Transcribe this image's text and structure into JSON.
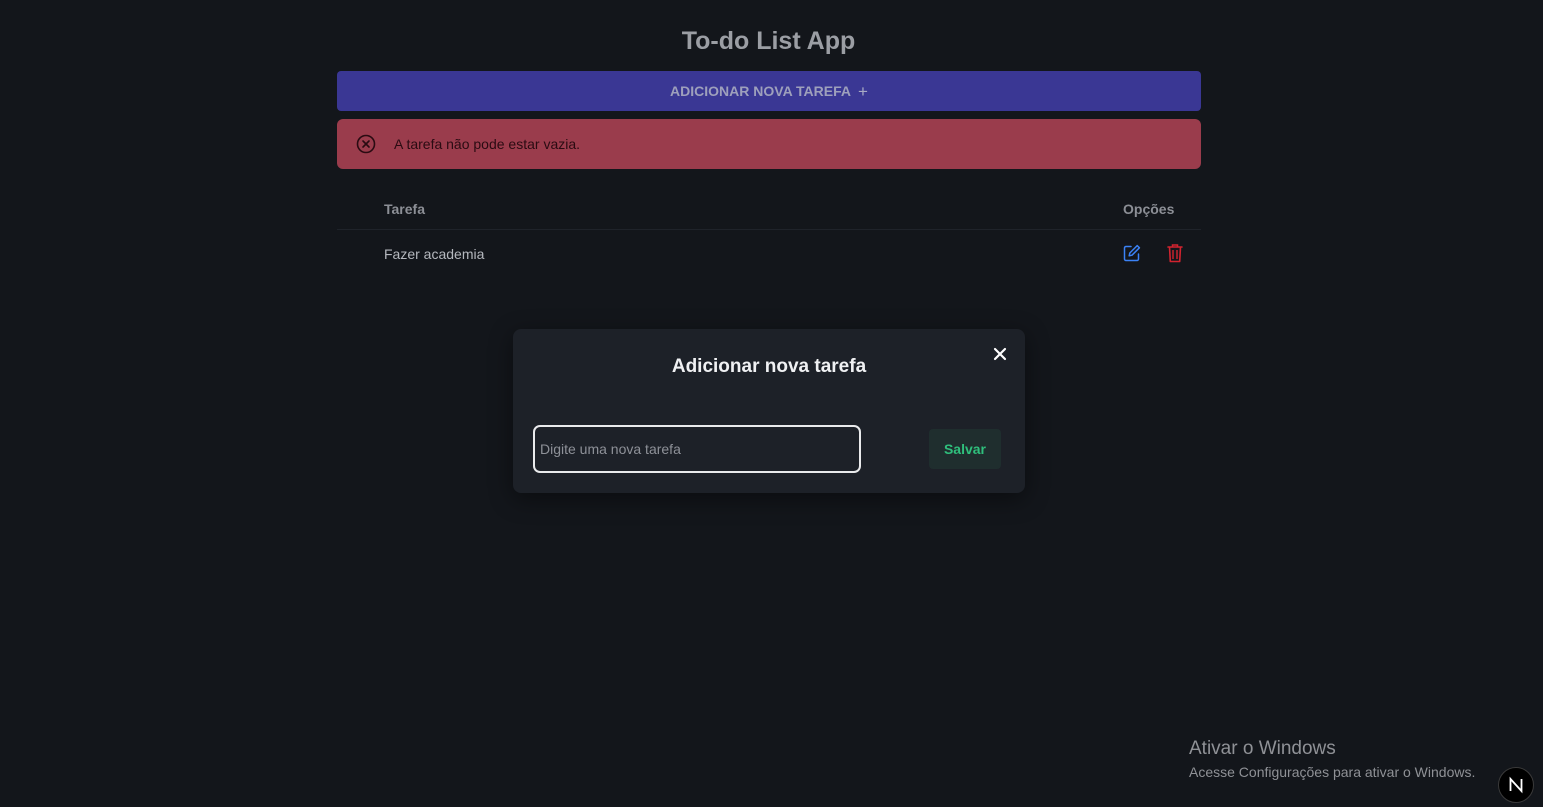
{
  "app": {
    "title": "To-do List App"
  },
  "toolbar": {
    "add_label": "ADICIONAR NOVA TAREFA",
    "add_icon": "plus-icon"
  },
  "alert": {
    "icon": "close-circle-icon",
    "message": "A tarefa não pode estar vazia.",
    "color": "#9a3c4c"
  },
  "table": {
    "headers": [
      "Tarefa",
      "Opções"
    ],
    "rows": [
      {
        "task": "Fazer academia",
        "actions": [
          "edit-icon",
          "trash-icon"
        ]
      }
    ]
  },
  "modal": {
    "title": "Adicionar nova tarefa",
    "close_icon": "close-icon",
    "input_value": "",
    "input_placeholder": "Digite uma nova tarefa",
    "save_label": "Salvar"
  },
  "watermark": {
    "title": "Ativar o Windows",
    "subtitle": "Acesse Configurações para ativar o Windows."
  },
  "badge": {
    "letter": "N"
  },
  "colors": {
    "background": "#13161b",
    "primary": "#3a3794",
    "danger": "#9a3c4c",
    "edit": "#3b82f6",
    "delete": "#d1232f",
    "save_text": "#2fbf7c"
  }
}
